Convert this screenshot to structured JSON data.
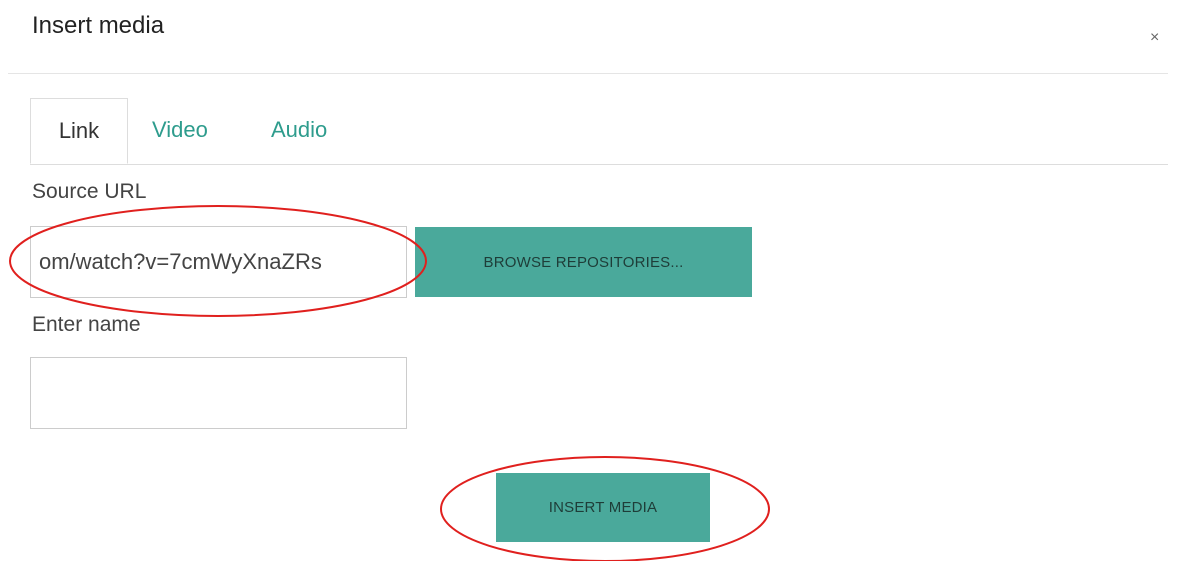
{
  "dialog": {
    "title": "Insert media",
    "close_icon": "×"
  },
  "tabs": [
    {
      "label": "Link",
      "active": true
    },
    {
      "label": "Video",
      "active": false
    },
    {
      "label": "Audio",
      "active": false
    }
  ],
  "form": {
    "source_label": "Source URL",
    "source_value": "om/watch?v=7cmWyXnaZRs",
    "browse_label": "BROWSE REPOSITORIES...",
    "name_label": "Enter name",
    "name_value": ""
  },
  "footer": {
    "insert_label": "INSERT MEDIA"
  },
  "colors": {
    "accent": "#4aa99b",
    "tab_link": "#2e9c8d",
    "annotation": "#e0201e"
  }
}
